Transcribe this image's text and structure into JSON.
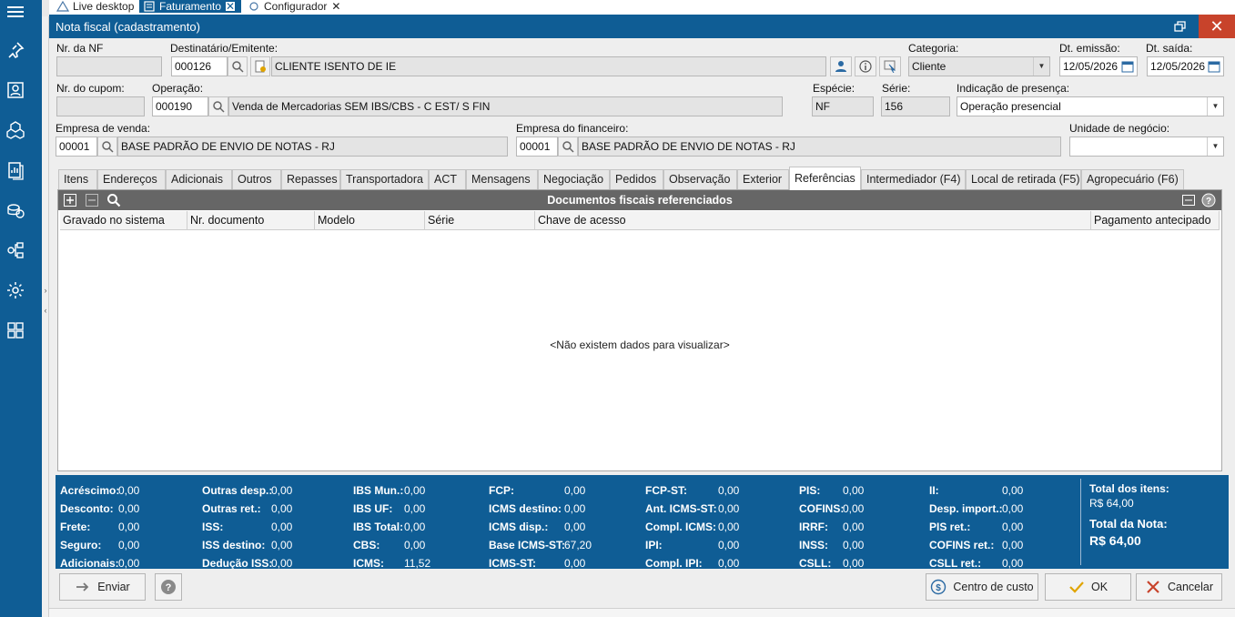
{
  "top_tabs": [
    {
      "label": "Live desktop"
    },
    {
      "label": "Faturamento"
    },
    {
      "label": "Configurador"
    }
  ],
  "window": {
    "title": "Nota fiscal (cadastramento)"
  },
  "form": {
    "nr_nf": {
      "label": "Nr. da NF",
      "value": ""
    },
    "destinatario": {
      "label": "Destinatário/Emitente:",
      "code": "000126",
      "name": "CLIENTE ISENTO DE IE"
    },
    "categoria": {
      "label": "Categoria:",
      "value": "Cliente"
    },
    "dt_emissao": {
      "label": "Dt. emissão:",
      "value": "12/05/2026"
    },
    "dt_saida": {
      "label": "Dt. saída:",
      "value": "12/05/2026"
    },
    "nr_cupom": {
      "label": "Nr. do cupom:",
      "value": ""
    },
    "operacao": {
      "label": "Operação:",
      "code": "000190",
      "desc": "Venda de Mercadorias SEM IBS/CBS  - C EST/ S FIN"
    },
    "especie": {
      "label": "Espécie:",
      "value": "NF"
    },
    "serie": {
      "label": "Série:",
      "value": "156"
    },
    "presenca": {
      "label": "Indicação de presença:",
      "value": "Operação presencial"
    },
    "empresa_venda": {
      "label": "Empresa de venda:",
      "code": "00001",
      "name": "BASE PADRÃO DE ENVIO DE NOTAS - RJ"
    },
    "empresa_fin": {
      "label": "Empresa do financeiro:",
      "code": "00001",
      "name": "BASE PADRÃO DE ENVIO DE NOTAS - RJ"
    },
    "unidade": {
      "label": "Unidade de negócio:",
      "value": ""
    }
  },
  "tabs": [
    {
      "label": "Itens"
    },
    {
      "label": "Endereços"
    },
    {
      "label": "Adicionais"
    },
    {
      "label": "Outros"
    },
    {
      "label": "Repasses"
    },
    {
      "label": "Transportadora"
    },
    {
      "label": "ACT"
    },
    {
      "label": "Mensagens"
    },
    {
      "label": "Negociação"
    },
    {
      "label": "Pedidos"
    },
    {
      "label": "Observação"
    },
    {
      "label": "Exterior"
    },
    {
      "label": "Referências"
    },
    {
      "label": "Intermediador (F4)"
    },
    {
      "label": "Local de retirada (F5)"
    },
    {
      "label": "Agropecuário (F6)"
    }
  ],
  "active_tab": "Referências",
  "panel": {
    "title": "Documentos fiscais referenciados",
    "columns": [
      "Gravado no sistema",
      "Nr. documento",
      "Modelo",
      "Série",
      "Chave de acesso",
      "Pagamento antecipado"
    ],
    "empty_text": "<Não existem dados para visualizar>"
  },
  "totals": {
    "c1": [
      {
        "label": "Acréscimo:",
        "value": "0,00"
      },
      {
        "label": "Desconto:",
        "value": "0,00"
      },
      {
        "label": "Frete:",
        "value": "0,00"
      },
      {
        "label": "Seguro:",
        "value": "0,00"
      },
      {
        "label": "Adicionais:",
        "value": "0,00"
      }
    ],
    "c2": [
      {
        "label": "Outras desp.:",
        "value": "0,00"
      },
      {
        "label": "Outras ret.:",
        "value": "0,00"
      },
      {
        "label": "ISS:",
        "value": "0,00"
      },
      {
        "label": "ISS destino:",
        "value": "0,00"
      },
      {
        "label": "Dedução ISS:",
        "value": "0,00"
      }
    ],
    "c3": [
      {
        "label": "IBS Mun.:",
        "value": "0,00"
      },
      {
        "label": "IBS UF:",
        "value": "0,00"
      },
      {
        "label": "IBS Total:",
        "value": "0,00"
      },
      {
        "label": "CBS:",
        "value": "0,00"
      },
      {
        "label": "ICMS:",
        "value": "11,52"
      }
    ],
    "c4": [
      {
        "label": "FCP:",
        "value": "0,00"
      },
      {
        "label": "ICMS destino:",
        "value": "0,00"
      },
      {
        "label": "ICMS disp.:",
        "value": "0,00"
      },
      {
        "label": "Base ICMS-ST:",
        "value": "67,20"
      },
      {
        "label": "ICMS-ST:",
        "value": "0,00"
      }
    ],
    "c5": [
      {
        "label": "FCP-ST:",
        "value": "0,00"
      },
      {
        "label": "Ant. ICMS-ST:",
        "value": "0,00"
      },
      {
        "label": "Compl. ICMS:",
        "value": "0,00"
      },
      {
        "label": "IPI:",
        "value": "0,00"
      },
      {
        "label": "Compl. IPI:",
        "value": "0,00"
      }
    ],
    "c6": [
      {
        "label": "PIS:",
        "value": "0,00"
      },
      {
        "label": "COFINS:",
        "value": "0,00"
      },
      {
        "label": "IRRF:",
        "value": "0,00"
      },
      {
        "label": "INSS:",
        "value": "0,00"
      },
      {
        "label": "CSLL:",
        "value": "0,00"
      }
    ],
    "c7": [
      {
        "label": "II:",
        "value": "0,00"
      },
      {
        "label": "Desp. import.:",
        "value": "0,00"
      },
      {
        "label": "PIS ret.:",
        "value": "0,00"
      },
      {
        "label": "COFINS ret.:",
        "value": "0,00"
      },
      {
        "label": "CSLL ret.:",
        "value": "0,00"
      }
    ],
    "total_itens_label": "Total dos itens:",
    "total_itens_value": "R$ 64,00",
    "total_nota_label": "Total da Nota:",
    "total_nota_value": "R$ 64,00"
  },
  "buttons": {
    "enviar": "Enviar",
    "centro_custo": "Centro de custo",
    "ok": "OK",
    "cancelar": "Cancelar"
  },
  "colors": {
    "primary": "#0f5d95",
    "close": "#c8432b",
    "ok_check": "#e0a400",
    "cancel_x": "#c8432b"
  }
}
